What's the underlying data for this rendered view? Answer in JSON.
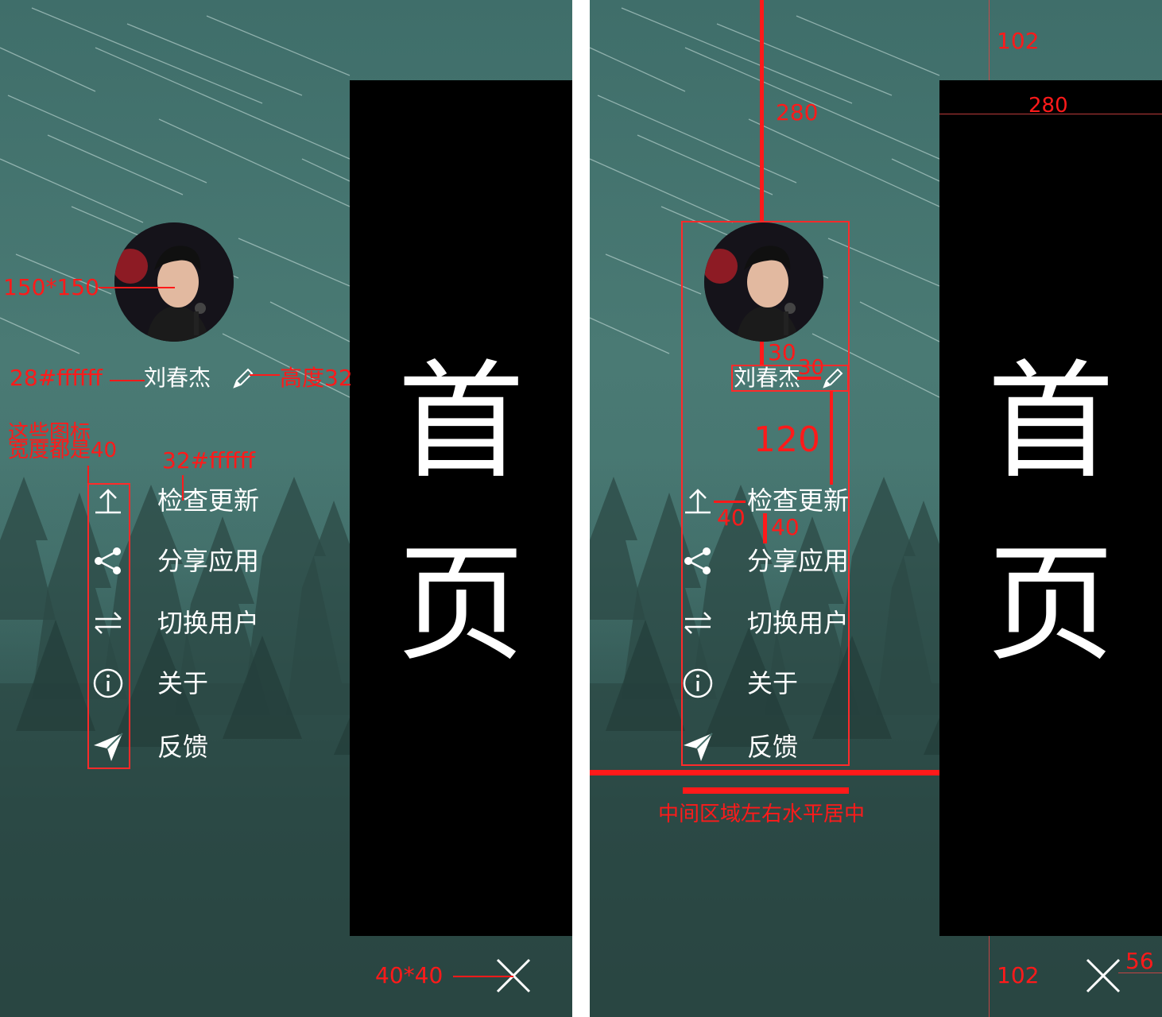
{
  "left_panel": {
    "side_title_chars": [
      "首",
      "页"
    ],
    "user_name": "刘春杰",
    "menu": [
      {
        "label": "检查更新",
        "icon": "upload-icon"
      },
      {
        "label": "分享应用",
        "icon": "share-icon"
      },
      {
        "label": "切换用户",
        "icon": "switch-icon"
      },
      {
        "label": "关于",
        "icon": "info-icon"
      },
      {
        "label": "反馈",
        "icon": "send-icon"
      }
    ],
    "annotations": {
      "avatar_size": "150*150",
      "name_style": "28#ffffff",
      "edit_icon_height": "高度32",
      "icons_note_line1": "这些图标",
      "icons_note_line2": "宽度都是40",
      "menu_text_style": "32#ffffff",
      "close_size": "40*40"
    }
  },
  "right_panel": {
    "side_title_chars": [
      "首",
      "页"
    ],
    "user_name": "刘春杰",
    "menu": [
      {
        "label": "检查更新",
        "icon": "upload-icon"
      },
      {
        "label": "分享应用",
        "icon": "share-icon"
      },
      {
        "label": "切换用户",
        "icon": "switch-icon"
      },
      {
        "label": "关于",
        "icon": "info-icon"
      },
      {
        "label": "反馈",
        "icon": "send-icon"
      }
    ],
    "annotations": {
      "top_offset": "280",
      "top_margin": "102",
      "black_width": "280",
      "avatar_gap": "30",
      "name_icon_gap": "30",
      "name_to_menu": "120",
      "icon_to_text": "40",
      "item_gap": "40",
      "center_note": "中间区域左右水平居中",
      "bottom_margin": "102",
      "close_offset": "56"
    }
  },
  "colors": {
    "annotation": "#ff1a1a",
    "text": "#ffffff",
    "side_panel": "#000000"
  }
}
